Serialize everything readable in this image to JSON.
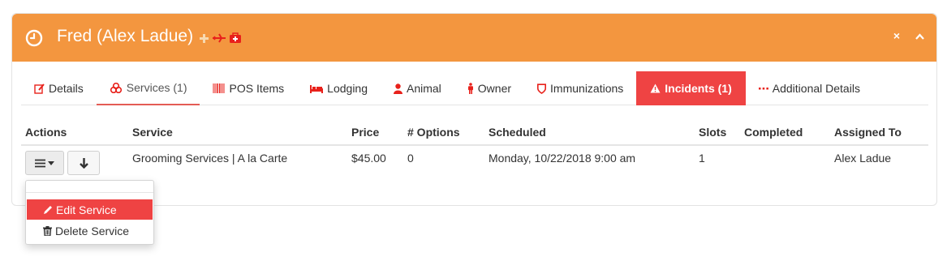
{
  "header": {
    "title": "Fred (Alex Ladue)",
    "background": "#f3963f",
    "badges": [
      "plus-icon",
      "plane-icon",
      "medical-kit-icon"
    ],
    "tools": {
      "close": "×",
      "collapse": "⌃"
    }
  },
  "tabs": [
    {
      "label": "Details",
      "icon": "edit-icon"
    },
    {
      "label": "Services (1)",
      "icon": "cubes-icon"
    },
    {
      "label": "POS Items",
      "icon": "barcode-icon"
    },
    {
      "label": "Lodging",
      "icon": "bed-icon"
    },
    {
      "label": "Animal",
      "icon": "user-icon"
    },
    {
      "label": "Owner",
      "icon": "person-icon"
    },
    {
      "label": "Immunizations",
      "icon": "shield-icon"
    },
    {
      "label": "Incidents (1)",
      "icon": "warning-icon",
      "color": "#ef4343"
    },
    {
      "label": "Additional Details",
      "icon": "ellipsis-icon"
    }
  ],
  "table": {
    "columns": [
      "Actions",
      "Service",
      "Price",
      "# Options",
      "Scheduled",
      "Slots",
      "Completed",
      "Assigned To"
    ],
    "rows": [
      {
        "service": "Grooming Services | A la Carte",
        "price": "$45.00",
        "options": "0",
        "scheduled": "Monday, 10/22/2018 9:00 am",
        "slots": "1",
        "completed": "",
        "assigned_to": "Alex Ladue"
      }
    ]
  },
  "actions_menu": {
    "items": [
      {
        "label": "Edit Service",
        "icon": "pencil-icon",
        "active": true
      },
      {
        "label": "Delete Service",
        "icon": "trash-icon",
        "active": false
      }
    ]
  },
  "colors": {
    "accent": "#ef4343",
    "header": "#f3963f"
  }
}
